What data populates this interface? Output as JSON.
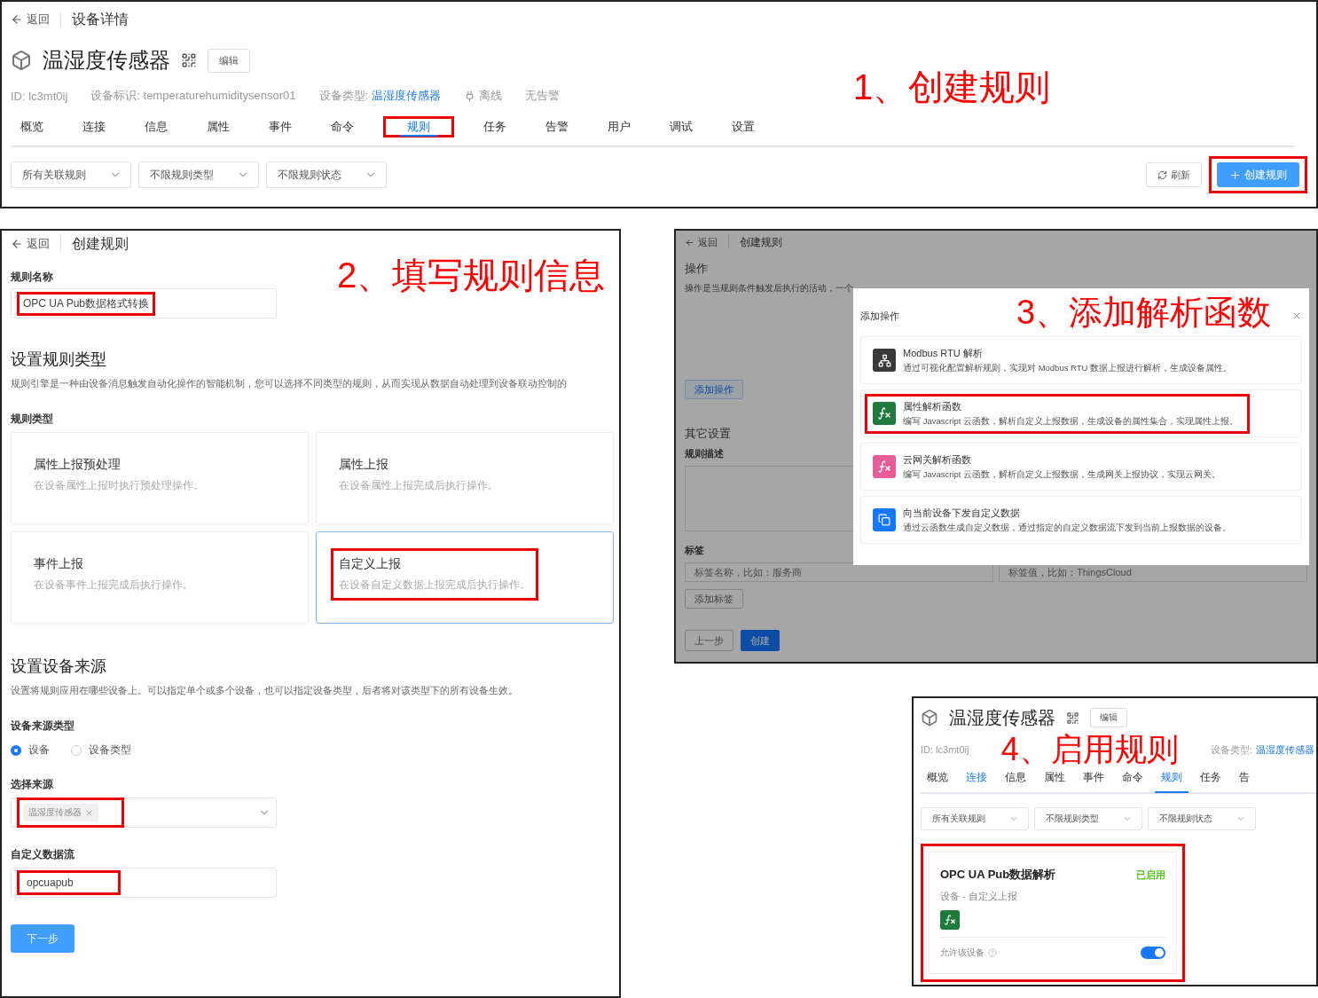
{
  "step1": {
    "annotation": "1、创建规则",
    "back": "返回",
    "title": "设备详情",
    "device_name": "温湿度传感器",
    "edit": "编辑",
    "info": [
      {
        "kind": "text",
        "text": "ID: lc3mt0ij"
      },
      {
        "kind": "text",
        "text": "设备标识: temperaturehumiditysensor01"
      },
      {
        "kind": "link",
        "label": "设备类型:",
        "link": "温湿度传感器"
      },
      {
        "kind": "status",
        "text": "离线"
      },
      {
        "kind": "text",
        "text": "无告警"
      }
    ],
    "tabs": [
      {
        "label": "概览",
        "selected": false,
        "highlighted": false
      },
      {
        "label": "连接",
        "selected": false,
        "highlighted": false
      },
      {
        "label": "信息",
        "selected": false,
        "highlighted": false
      },
      {
        "label": "属性",
        "selected": false,
        "highlighted": false
      },
      {
        "label": "事件",
        "selected": false,
        "highlighted": false
      },
      {
        "label": "命令",
        "selected": false,
        "highlighted": false
      },
      {
        "label": "规则",
        "selected": true,
        "highlighted": true
      },
      {
        "label": "任务",
        "selected": false,
        "highlighted": false
      },
      {
        "label": "告警",
        "selected": false,
        "highlighted": false
      },
      {
        "label": "用户",
        "selected": false,
        "highlighted": false
      },
      {
        "label": "调试",
        "selected": false,
        "highlighted": false
      },
      {
        "label": "设置",
        "selected": false,
        "highlighted": false
      }
    ],
    "filters": [
      "所有关联规则",
      "不限规则类型",
      "不限规则状态"
    ],
    "refresh": "刷新",
    "create": {
      "label": "创建规则",
      "highlighted": true
    }
  },
  "step2": {
    "annotation": "2、填写规则信息",
    "back": "返回",
    "title": "创建规则",
    "name_field": {
      "label": "规则名称",
      "value": "OPC UA Pub数据格式转换",
      "highlighted": true
    },
    "type_section": {
      "heading": "设置规则类型",
      "description": "规则引擎是一种由设备消息触发自动化操作的智能机制，您可以选择不同类型的规则，从而实现从数据自动处理到设备联动控制的",
      "label": "规则类型",
      "options": [
        {
          "title": "属性上报预处理",
          "description": "在设备属性上报时执行预处理操作。",
          "selected": false,
          "highlighted": false
        },
        {
          "title": "属性上报",
          "description": "在设备属性上报完成后执行操作。",
          "selected": false,
          "highlighted": false
        },
        {
          "title": "事件上报",
          "description": "在设备事件上报完成后执行操作。",
          "selected": false,
          "highlighted": false
        },
        {
          "title": "自定义上报",
          "description": "在设备自定义数据上报完成后执行操作。",
          "selected": true,
          "highlighted": true
        }
      ]
    },
    "source_section": {
      "heading": "设置设备来源",
      "description": "设置将规则应用在哪些设备上。可以指定单个或多个设备，也可以指定设备类型，后者将对该类型下的所有设备生效。",
      "source_type": {
        "label": "设备来源类型",
        "options": [
          {
            "label": "设备",
            "selected": true
          },
          {
            "label": "设备类型",
            "selected": false
          }
        ]
      },
      "source": {
        "label": "选择来源",
        "tags": [
          "温湿度传感器"
        ],
        "highlighted": true
      },
      "stream": {
        "label": "自定义数据流",
        "value": "opcuapub",
        "highlighted": true
      }
    },
    "next": "下一步"
  },
  "step3": {
    "annotation": "3、添加解析函数",
    "back": "返回",
    "title": "创建规则",
    "section": "操作",
    "section_description": "操作是当规则条件触发后执行的活动，一个",
    "add_action": "添加操作",
    "other": "其它设置",
    "desc_label": "规则描述",
    "tag_label": "标签",
    "tag_name_placeholder": "标签名称，比如：服务商",
    "tag_value_placeholder": "标签值，比如：ThingsCloud",
    "add_tag": "添加标签",
    "prev": "上一步",
    "create": "创建",
    "dialog": {
      "title": "添加操作",
      "options": [
        {
          "kind": "modbus",
          "title": "Modbus RTU 解析",
          "description": "通过可视化配置解析规则，实现对 Modbus RTU 数据上报进行解析，生成设备属性。",
          "highlighted": false
        },
        {
          "kind": "property_function",
          "title": "属性解析函数",
          "description": "编写 Javascript 云函数，解析自定义上报数据，生成设备的属性集合，实现属性上报。",
          "highlighted": true
        },
        {
          "kind": "gateway_function",
          "title": "云网关解析函数",
          "description": "编写 Javascript 云函数，解析自定义上报数据，生成网关上报协议，实现云网关。",
          "highlighted": false
        },
        {
          "kind": "downlink",
          "title": "向当前设备下发自定义数据",
          "description": "通过云函数生成自定义数据，通过指定的自定义数据流下发到当前上报数据的设备。",
          "highlighted": false
        }
      ]
    }
  },
  "step4": {
    "annotation": "4、启用规则",
    "device_name": "温湿度传感器",
    "edit": "编辑",
    "info": [
      {
        "kind": "text",
        "text": "ID: lc3mt0ij"
      },
      {
        "kind": "link",
        "label": "设备类型:",
        "link": "温湿度传感器"
      }
    ],
    "tabs": [
      {
        "label": "概览",
        "selected": false,
        "hovered": false
      },
      {
        "label": "连接",
        "selected": false,
        "hovered": true
      },
      {
        "label": "信息",
        "selected": false,
        "hovered": false
      },
      {
        "label": "属性",
        "selected": false,
        "hovered": false
      },
      {
        "label": "事件",
        "selected": false,
        "hovered": false
      },
      {
        "label": "命令",
        "selected": false,
        "hovered": false
      },
      {
        "label": "规则",
        "selected": true,
        "hovered": false
      },
      {
        "label": "任务",
        "selected": false,
        "hovered": false
      },
      {
        "label": "告",
        "selected": false,
        "hovered": false
      }
    ],
    "filters": [
      "所有关联规则",
      "不限规则类型",
      "不限规则状态"
    ],
    "rule": {
      "title": "OPC UA Pub数据解析",
      "status": "已启用",
      "subtitle": "设备 - 自定义上报",
      "allow_label": "允许该设备",
      "enabled": true,
      "highlighted": true
    }
  }
}
